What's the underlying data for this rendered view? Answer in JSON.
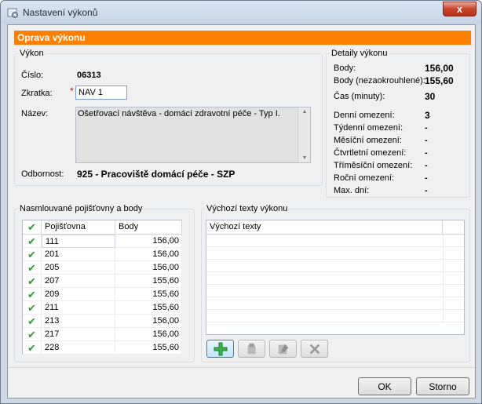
{
  "window": {
    "title": "Nastavení výkonů",
    "close_glyph": "x"
  },
  "banner": "Oprava výkonu",
  "vykon": {
    "legend": "Výkon",
    "cislo_label": "Číslo:",
    "cislo_value": "06313",
    "zkratka_label": "Zkratka:",
    "zkratka_value": "NAV 1",
    "required_mark": "*",
    "nazev_label": "Název:",
    "nazev_value": "Ošetřovací návštěva - domácí zdravotní péče - Typ I.",
    "odbornost_label": "Odbornost:",
    "odbornost_value": "925 - Pracoviště domácí péče - SZP"
  },
  "detaily": {
    "legend": "Detaily výkonu",
    "rows": [
      {
        "label": "Body:",
        "value": "156,00"
      },
      {
        "label": "Body (nezaokrouhlené):",
        "value": "155,60"
      },
      {
        "label": "Čas (minuty):",
        "value": "30"
      },
      {
        "label": "Denní omezení:",
        "value": "3"
      },
      {
        "label": "Týdenní omezení:",
        "value": "-"
      },
      {
        "label": "Měsíční omezení:",
        "value": "-"
      },
      {
        "label": "Čtvrtletní omezení:",
        "value": "-"
      },
      {
        "label": "Tříměsíční omezení:",
        "value": "-"
      },
      {
        "label": "Roční omezení:",
        "value": "-"
      },
      {
        "label": "Max. dní:",
        "value": "-"
      }
    ]
  },
  "pojistovny": {
    "legend": "Nasmlouvané pojišťovny a body",
    "columns": [
      "Pojišťovna",
      "Body"
    ],
    "rows": [
      {
        "check": "✔",
        "code": "111",
        "body": "156,00"
      },
      {
        "check": "✔",
        "code": "201",
        "body": "156,00"
      },
      {
        "check": "✔",
        "code": "205",
        "body": "156,00"
      },
      {
        "check": "✔",
        "code": "207",
        "body": "155,60"
      },
      {
        "check": "✔",
        "code": "209",
        "body": "155,60"
      },
      {
        "check": "✔",
        "code": "211",
        "body": "155,60"
      },
      {
        "check": "✔",
        "code": "213",
        "body": "156,00"
      },
      {
        "check": "✔",
        "code": "217",
        "body": "156,00"
      },
      {
        "check": "✔",
        "code": "228",
        "body": "155,60"
      }
    ],
    "header_check": "✔"
  },
  "texty": {
    "legend": "Výchozí texty výkonu",
    "column": "Výchozí texty",
    "tools": [
      {
        "name": "add-icon",
        "glyph": "+"
      },
      {
        "name": "edit-icon",
        "glyph": ""
      },
      {
        "name": "edit-document-icon",
        "glyph": ""
      },
      {
        "name": "delete-icon",
        "glyph": "✕"
      }
    ]
  },
  "buttons": {
    "ok": "OK",
    "cancel": "Storno"
  },
  "colors": {
    "banner": "#ff8000",
    "check": "#2f9c2f"
  }
}
